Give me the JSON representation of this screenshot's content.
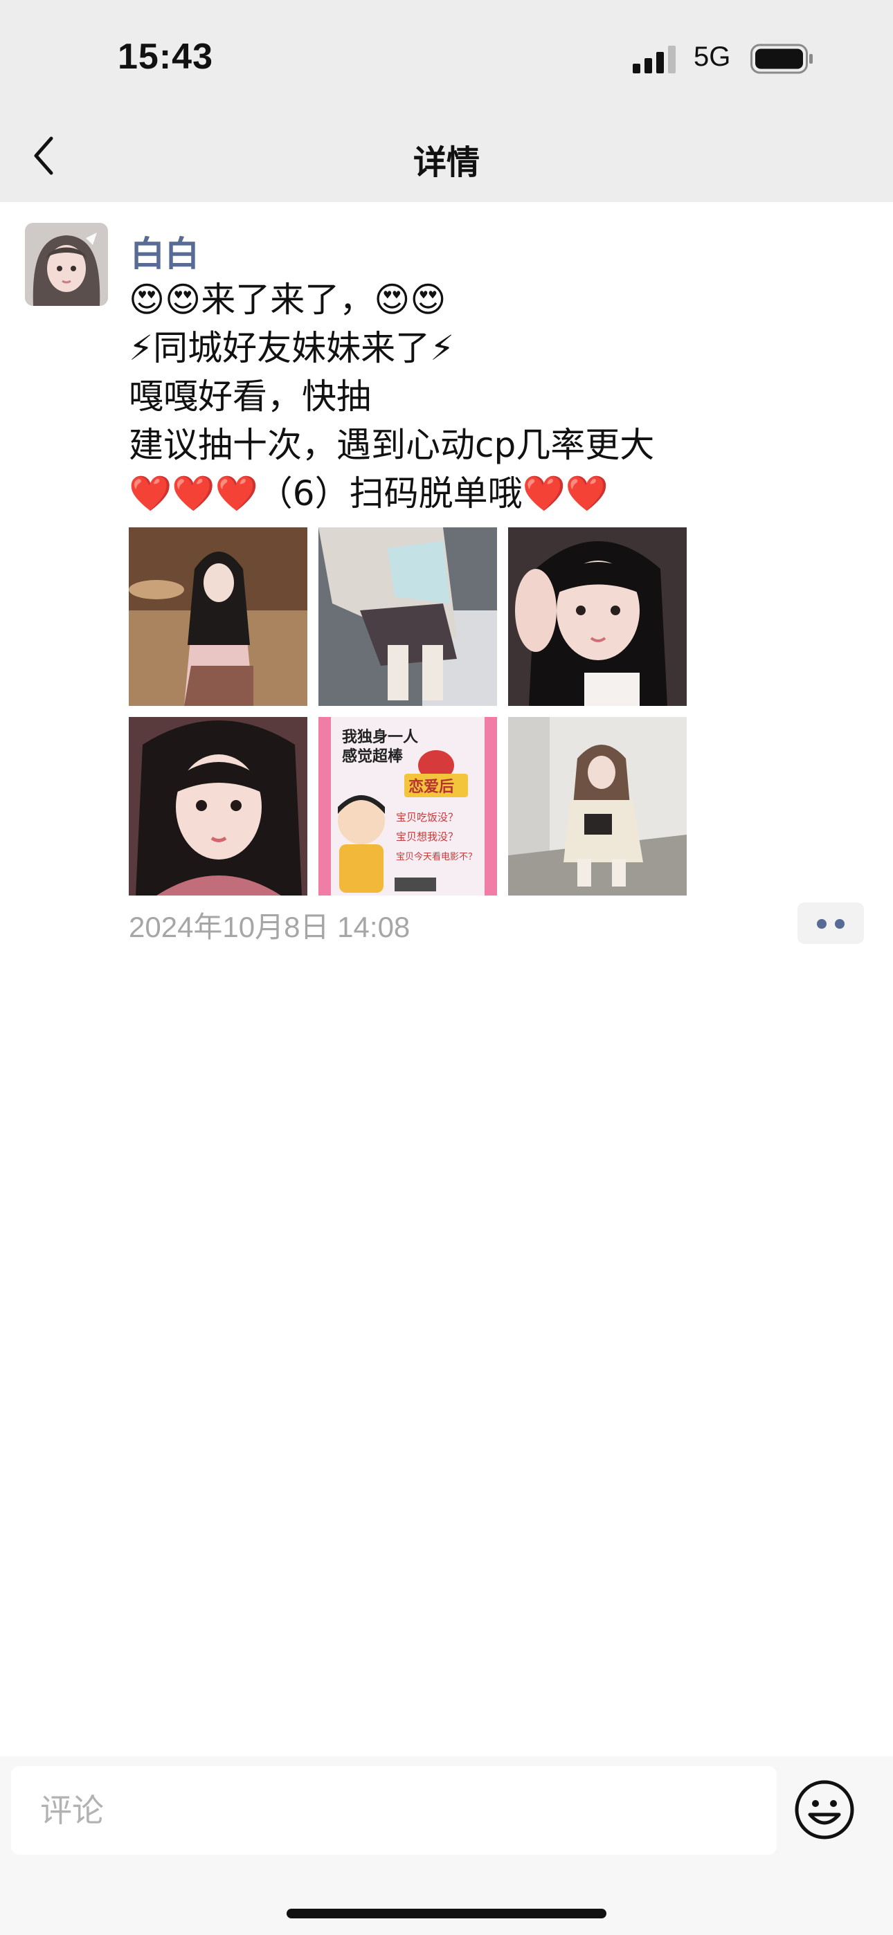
{
  "status_bar": {
    "time": "15:43",
    "network": "5G"
  },
  "nav": {
    "title": "详情"
  },
  "post": {
    "author": "白白",
    "lines": [
      "😍😍来了来了，😍😍",
      " ⚡同城好友妹妹来了⚡",
      "嘎嘎好看，快抽",
      "建议抽十次，遇到心动cp几率更大",
      "❤️❤️❤️（6）扫码脱单哦❤️❤️"
    ],
    "images": [
      "photo-1",
      "photo-2",
      "photo-3",
      "photo-4",
      "poster",
      "photo-6"
    ],
    "poster_text": [
      "我独身一人",
      "感觉超棒",
      "恋爱后",
      "宝贝吃饭没？",
      "宝贝想我没？",
      "宝贝今天看电影不？"
    ],
    "timestamp": "2024年10月8日 14:08"
  },
  "comment": {
    "placeholder": "评论"
  },
  "icons": {
    "back": "chevron-left-icon",
    "more": "more-dots-icon",
    "emoji": "smiley-icon"
  },
  "colors": {
    "author_link": "#576b95",
    "header_bg": "#ededed",
    "timestamp": "#a6a6a6"
  }
}
